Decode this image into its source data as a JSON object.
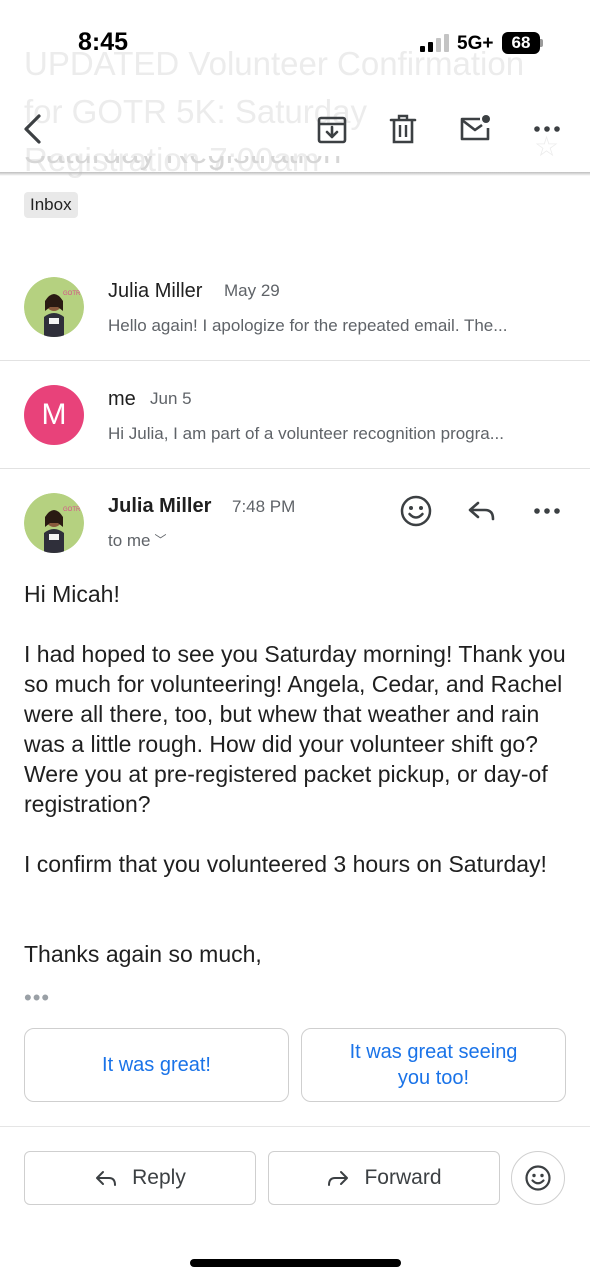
{
  "status_bar": {
    "time": "8:45",
    "network": "5G+",
    "battery": "68"
  },
  "email": {
    "subject": "UPDATED Volunteer Confirmation for GOTR 5K: Saturday Registration 7:00am",
    "label": "Inbox"
  },
  "toolbar": {
    "icons": [
      "back-icon",
      "archive-icon",
      "delete-icon",
      "mark-unread-icon",
      "more-icon"
    ]
  },
  "messages": [
    {
      "sender": "Julia Miller",
      "date": "May 29",
      "snippet": "Hello again! I apologize for the repeated email. The..."
    },
    {
      "sender": "me",
      "avatar_letter": "M",
      "date": "Jun 5",
      "snippet": "Hi Julia, I am part of a volunteer recognition progra..."
    }
  ],
  "open_message": {
    "sender": "Julia Miller",
    "time": "7:48 PM",
    "recipient": "to me",
    "greeting": "Hi Micah!",
    "paragraph1": "I had hoped to see you Saturday morning! Thank you so much for volunteering! Angela, Cedar, and Rachel were all there, too, but whew that weather and rain was a little rough. How did your volunteer shift go? Were you at pre-registered packet pickup, or day-of registration?",
    "paragraph2": "I confirm that you volunteered 3 hours on Saturday!",
    "closing": "Thanks again so much,",
    "trimmed": "•••"
  },
  "smart_replies": [
    "It was great!",
    "It was great seeing you too!"
  ],
  "actions": {
    "reply": "Reply",
    "forward": "Forward"
  },
  "colors": {
    "accent": "#1a73e8",
    "me_avatar": "#e8427a",
    "avatar_bg": "#a8c96a"
  }
}
